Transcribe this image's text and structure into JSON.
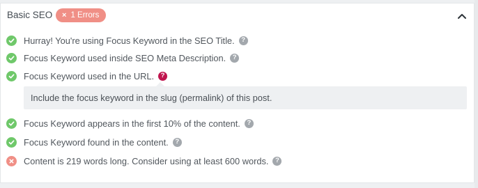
{
  "section": {
    "title": "Basic SEO",
    "error_badge": "1 Errors",
    "error_badge_icon": "×"
  },
  "checks": [
    {
      "status": "pass",
      "text": "Hurray! You're using Focus Keyword in the SEO Title."
    },
    {
      "status": "pass",
      "text": "Focus Keyword used inside SEO Meta Description."
    },
    {
      "status": "pass",
      "text": "Focus Keyword used in the URL."
    },
    {
      "status": "pass",
      "text": "Focus Keyword appears in the first 10% of the content."
    },
    {
      "status": "pass",
      "text": "Focus Keyword found in the content."
    },
    {
      "status": "fail",
      "text": "Content is 219 words long. Consider using at least 600 words."
    }
  ],
  "tooltip": {
    "text": "Include the focus keyword in the slug (permalink) of this post."
  },
  "help_glyph": "?",
  "colors": {
    "pass": "#6fc86a",
    "fail": "#f08f86",
    "help_active": "#c0154e",
    "help_default": "#a3a8ad"
  }
}
